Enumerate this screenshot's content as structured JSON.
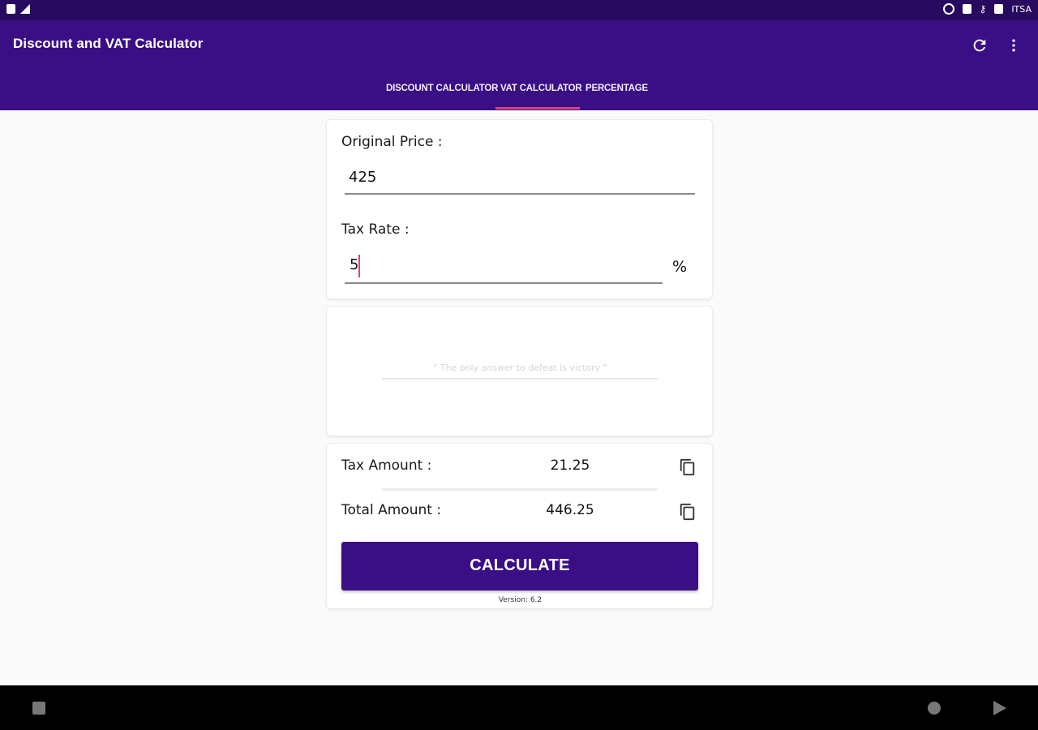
{
  "statusbar": {
    "right_text": "ITSA"
  },
  "appbar": {
    "title": "Discount and VAT Calculator",
    "refresh_icon": "refresh-icon",
    "more_icon": "more-vert-icon"
  },
  "tabs": [
    {
      "label": "DISCOUNT CALCULATOR",
      "selected": false
    },
    {
      "label": "VAT CALCULATOR",
      "selected": true
    },
    {
      "label": "PERCENTAGE",
      "selected": false
    }
  ],
  "form": {
    "original_price_label": "Original Price :",
    "original_price_value": "425",
    "tax_rate_label": "Tax Rate :",
    "tax_rate_value": "5",
    "percent_symbol": "%"
  },
  "quote": {
    "text": "\" The only answer to defeat is victory \""
  },
  "results": {
    "tax_amount_label": "Tax Amount :",
    "tax_amount_value": "21.25",
    "total_amount_label": "Total Amount :",
    "total_amount_value": "446.25",
    "calculate_label": "CALCULATE",
    "version": "Version:  6.2"
  },
  "colors": {
    "primary": "#3a0f86",
    "status_bar": "#27095f",
    "accent": "#e0407a"
  }
}
